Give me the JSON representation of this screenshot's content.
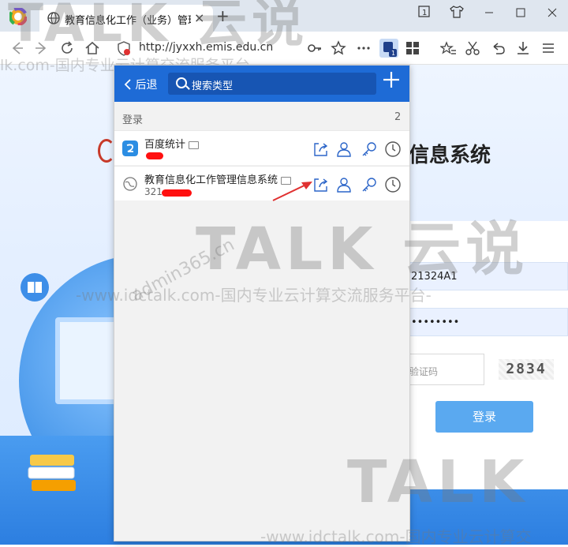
{
  "browser": {
    "tab_title": "教育信息化工作（业务）管理",
    "close_glyph": "×",
    "new_tab_glyph": "+",
    "url": "http://jyxxh.emis.edu.cn"
  },
  "page": {
    "site_title": "信息系统",
    "username_value": "21324A1",
    "password_value": "••••••••",
    "captcha_placeholder": "验证码",
    "captcha_code": "2834",
    "login_button": "登录"
  },
  "watermark": {
    "brand_top": "TALK 云说",
    "line_top": "lk.com-国内专业云计算交流服务平台-",
    "brand_mid": "TALK 云说",
    "line_mid": "-www.idctalk.com-国内专业云计算交流服务平台-",
    "brand_bottom": "TALK",
    "line_bottom": "-www.idctalk.com-国内专业云计算交",
    "diag": "admin365.cn"
  },
  "popup": {
    "back_label": "后退",
    "search_placeholder": "搜索类型",
    "section_label": "登录",
    "section_count": "2",
    "items": [
      {
        "name": "百度统计",
        "sub": ""
      },
      {
        "name": "教育信息化工作管理信息系统",
        "sub": "321"
      }
    ]
  },
  "colors": {
    "popup_header": "#1e6bd6",
    "action_icon": "#2a64c8",
    "login_button": "#5aa9f0",
    "redaction": "#ff1010"
  }
}
